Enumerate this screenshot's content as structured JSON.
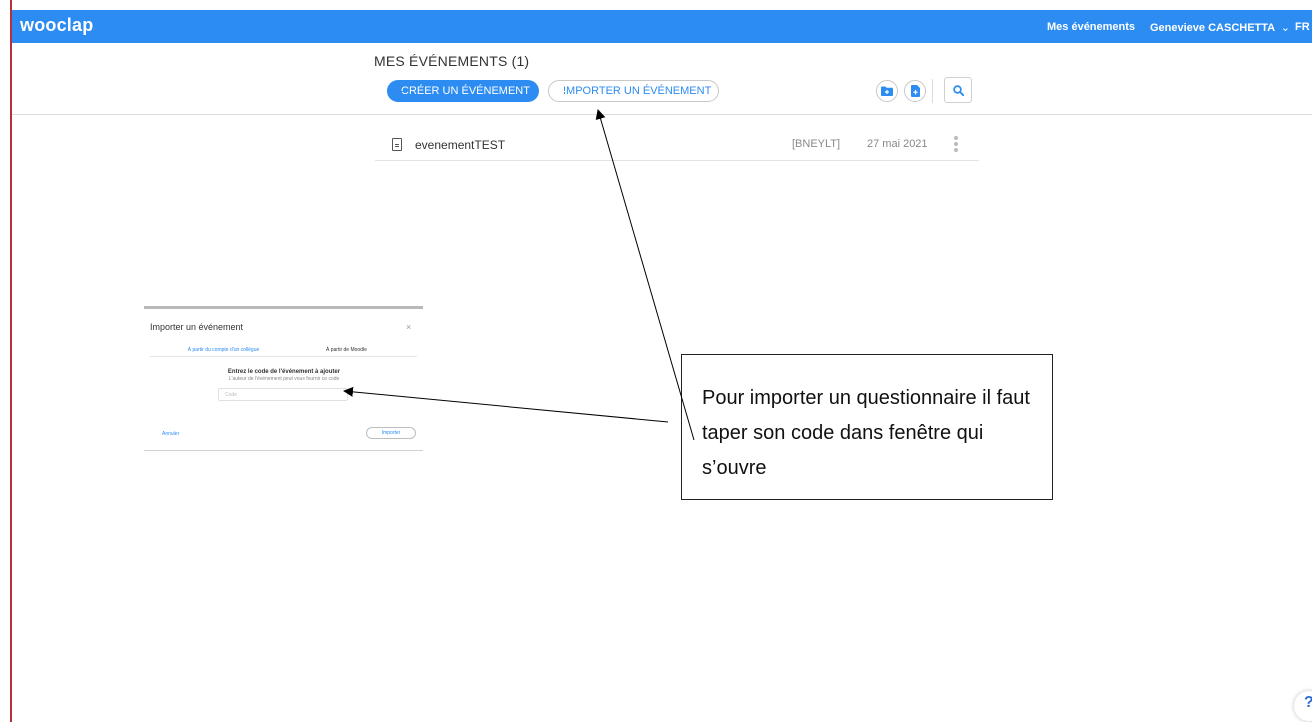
{
  "header": {
    "logo": "wooclap",
    "nav_events": "Mes événements",
    "nav_user": "Genevieve CASCHETTA",
    "nav_lang": "FR"
  },
  "toolbar": {
    "title": "MES ÉVÉNEMENTS (1)",
    "create_label": "CRÉER UN ÉVÉNEMENT",
    "import_label": "IMPORTER UN ÉVÉNEMENT"
  },
  "events": [
    {
      "name": "evenementTEST",
      "code": "[BNEYLT]",
      "date": "27 mai 2021"
    }
  ],
  "dialog": {
    "title": "Importer un événement",
    "close": "×",
    "tabs": [
      "À partir du compte d'un collègue",
      "À partir de Moodle"
    ],
    "prompt": "Entrez le code de l'événement à ajouter",
    "hint": "L'auteur de l'événement peut vous fournir ce code",
    "input_placeholder": "Code",
    "cancel": "Annuler",
    "import": "Importer"
  },
  "callout": {
    "text": "Pour importer un questionnaire il faut taper son code dans fenêtre qui s’ouvre"
  },
  "help_label": "?",
  "colors": {
    "brand": "#2c8cf2",
    "left_edge": "#b5313a"
  },
  "icons": [
    "plus-circle-icon",
    "folder-plus-icon",
    "file-plus-icon",
    "search-icon",
    "document-icon",
    "kebab-icon",
    "chevron-down-icon",
    "help-icon"
  ]
}
